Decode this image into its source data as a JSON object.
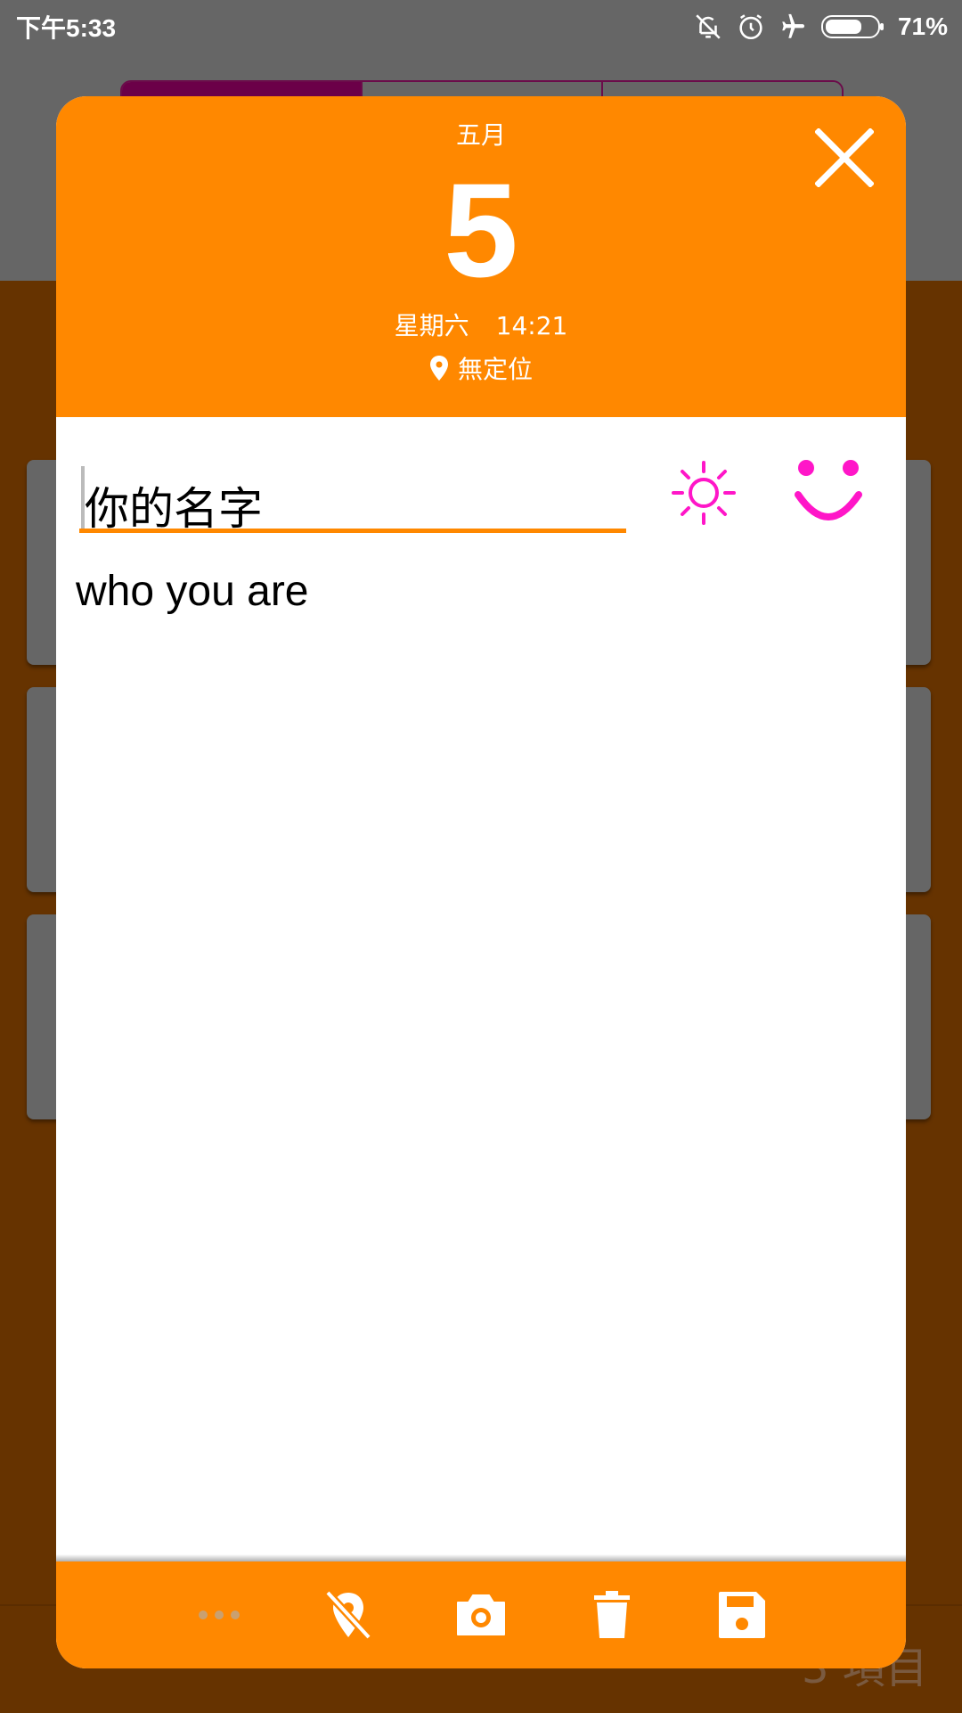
{
  "status_bar": {
    "time": "下午5:33",
    "battery_percent": "71%",
    "battery_level": 0.71,
    "icons": [
      "bell-off-icon",
      "alarm-icon",
      "airplane-icon",
      "battery-icon"
    ]
  },
  "dialog": {
    "header": {
      "month": "五月",
      "day": "5",
      "weekday": "星期六",
      "time": "14:21",
      "location": "無定位"
    },
    "title_placeholder": "你的名字",
    "body_text": "who you are",
    "weather_icon": "sun-icon",
    "mood_icon": "smiley-icon",
    "toolbar": [
      "more-icon",
      "location-off-icon",
      "camera-icon",
      "delete-icon",
      "save-icon"
    ]
  },
  "background_app": {
    "bottom_label": "3 項目"
  },
  "colors": {
    "accent": "#ff8800",
    "icon_pink": "#ff16c8",
    "scrim_gray": "#666666",
    "scrim_brown": "#663300"
  }
}
